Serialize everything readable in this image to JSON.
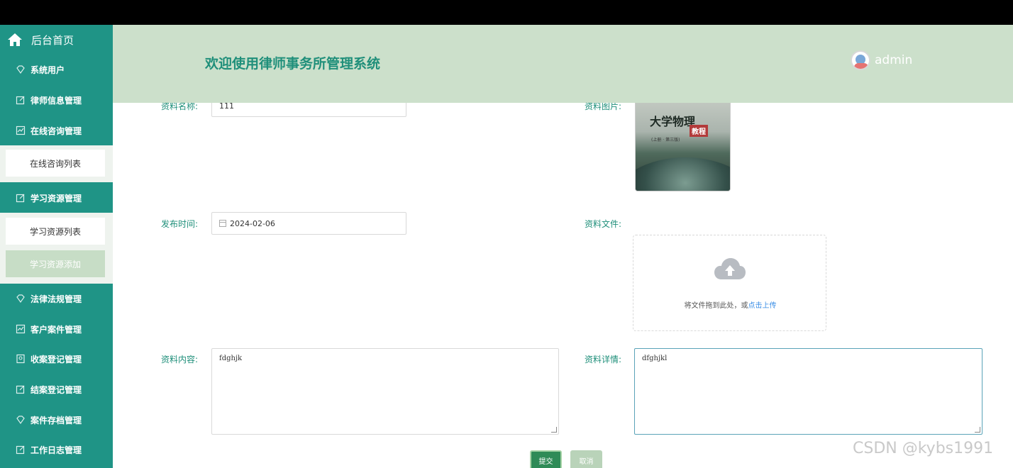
{
  "header": {
    "title": "欢迎使用律师事务所管理系统",
    "username": "admin"
  },
  "sidebar": {
    "home": "后台首页",
    "items": [
      {
        "label": "系统用户"
      },
      {
        "label": "律师信息管理"
      },
      {
        "label": "在线咨询管理"
      },
      {
        "label": "学习资源管理"
      },
      {
        "label": "法律法规管理"
      },
      {
        "label": "客户案件管理"
      },
      {
        "label": "收案登记管理"
      },
      {
        "label": "结案登记管理"
      },
      {
        "label": "案件存档管理"
      },
      {
        "label": "工作日志管理"
      }
    ],
    "sub_consult": "在线咨询列表",
    "sub_resource_list": "学习资源列表",
    "sub_resource_add": "学习资源添加"
  },
  "form": {
    "name_label": "资料名称:",
    "name_value": "111",
    "image_label": "资料图片:",
    "image_title": "大学物理",
    "image_subtitle": "教程",
    "image_edition": "(上册 · 第三版)",
    "time_label": "发布时间:",
    "time_value": "2024-02-06",
    "file_label": "资料文件:",
    "upload_text": "将文件拖到此处，或",
    "upload_link": "点击上传",
    "content_label": "资料内容:",
    "content_value": "fdghjk",
    "detail_label": "资料详情:",
    "detail_value": "dfghjkl"
  },
  "buttons": {
    "submit": "提交",
    "cancel": "取消"
  },
  "watermark": "CSDN @kybs1991",
  "colors": {
    "sidebar": "#1f9486",
    "header": "#cce0cb",
    "accent": "#1f8f7a"
  }
}
